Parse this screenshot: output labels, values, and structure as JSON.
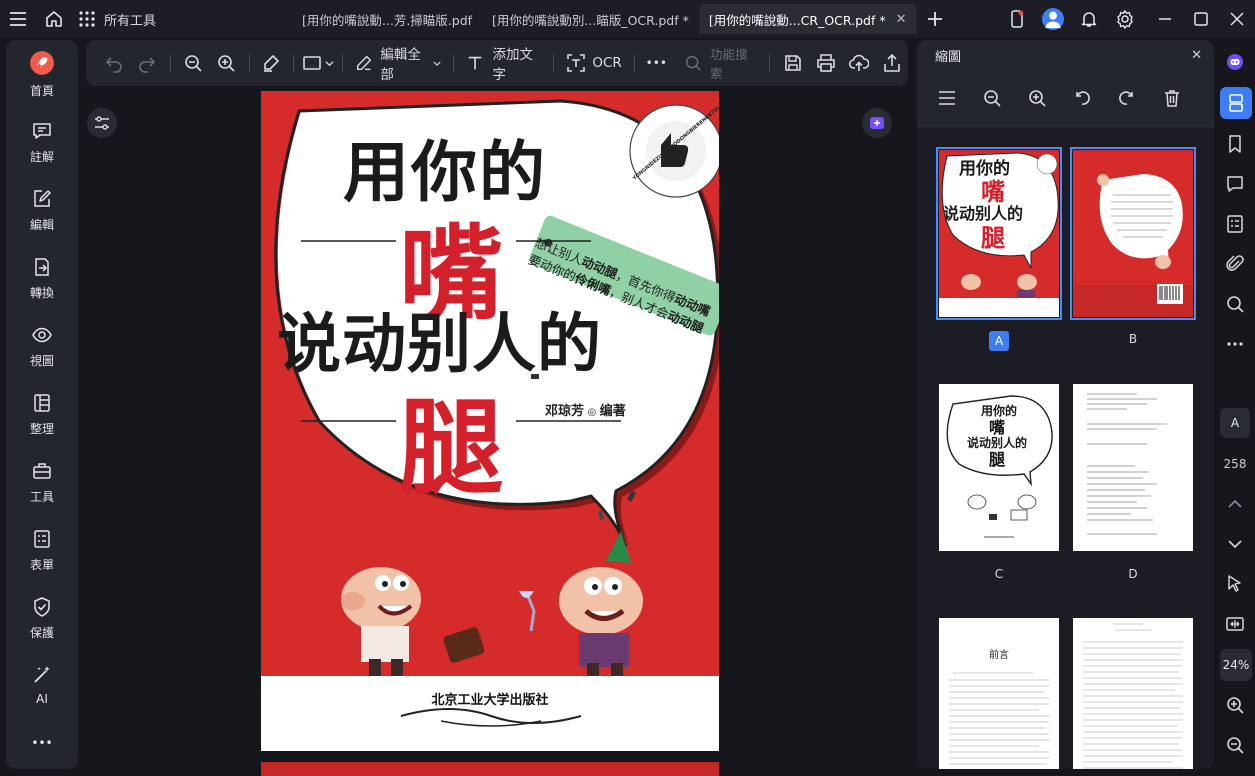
{
  "titlebar": {
    "all_tools": "所有工具",
    "tabs": [
      {
        "label": "[用你的嘴說動...芳.掃瞄版.pdf"
      },
      {
        "label": "[用你的嘴說動別...瞄版_OCR.pdf *"
      },
      {
        "label": "[用你的嘴說動...CR_OCR.pdf *",
        "close": "✕"
      }
    ]
  },
  "sidebar": {
    "items": [
      {
        "label": "首頁"
      },
      {
        "label": "註解"
      },
      {
        "label": "編輯"
      },
      {
        "label": "轉換"
      },
      {
        "label": "視圖"
      },
      {
        "label": "整理"
      },
      {
        "label": "工具"
      },
      {
        "label": "表單"
      },
      {
        "label": "保護"
      },
      {
        "label": "AI"
      }
    ],
    "more": "•••"
  },
  "toolbar": {
    "edit_all": "編輯全部",
    "add_text": "添加文字",
    "ocr": "OCR",
    "more": "•••",
    "search_placeholder": "功能搜索"
  },
  "cover": {
    "title_line1": "用你的",
    "title_big1": "嘴",
    "title_line2": "说动别人的",
    "title_big2": "腿",
    "tagline_line1_a": "想让别人",
    "tagline_line1_b": "动动腿",
    "tagline_line1_c": "，首先你得",
    "tagline_line1_d": "动动嘴",
    "tagline_line2_a": "要动你的",
    "tagline_line2_b": "伶俐嘴",
    "tagline_line2_c": "，别人才会",
    "tagline_line2_d": "动动腿",
    "author": "邓琼芳",
    "author_suffix": "编著",
    "publisher": "北京工业大学出版社",
    "stamp": "YONGNIDEZUI SHUODONGBIERENDETUI"
  },
  "thumbnails": {
    "title": "縮圖",
    "close": "✕",
    "pages": [
      {
        "label": "A",
        "selected": true
      },
      {
        "label": "B",
        "selected": false
      },
      {
        "label": "C",
        "selected": false
      },
      {
        "label": "D",
        "selected": false
      }
    ],
    "preface": "前言"
  },
  "rail": {
    "page_label": "A",
    "page_count": "258",
    "zoom": "24%"
  },
  "colors": {
    "accent": "#3d7df5",
    "cover_red": "#d52b2b",
    "title_red": "#d4202a"
  }
}
